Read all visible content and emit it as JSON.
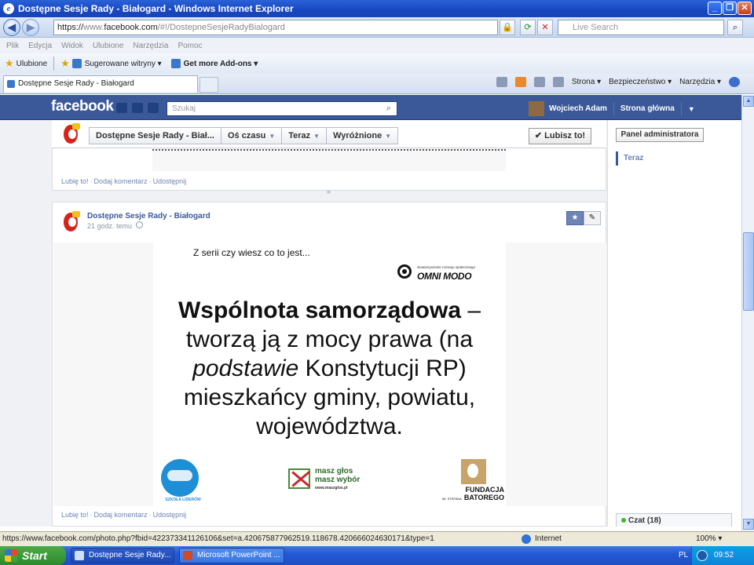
{
  "window": {
    "title": "Dostępne Sesje Rady - Białogard - Windows Internet Explorer"
  },
  "browser": {
    "url_scheme": "https://",
    "url_host_prefix": "www.",
    "url_host": "facebook.com",
    "url_path": "/#!/DostepneSesjeRadyBialogard",
    "live_search_placeholder": "Live Search",
    "menu": [
      "Plik",
      "Edycja",
      "Widok",
      "Ulubione",
      "Narzędzia",
      "Pomoc"
    ],
    "favorites_label": "Ulubione",
    "favorites_items": [
      "Sugerowane witryny ▾",
      "Get more Add-ons ▾"
    ],
    "tab_title": "Dostępne Sesje Rady - Białogard",
    "tools": [
      "Strona ▾",
      "Bezpieczeństwo ▾",
      "Narzędzia ▾"
    ],
    "status_url": "https://www.facebook.com/photo.php?fbid=422373341126106&set=a.420675877962519.118678.420666024630171&type=1",
    "zone": "Internet",
    "zoom": "100%"
  },
  "facebook": {
    "logo": "facebook",
    "search_placeholder": "Szukaj",
    "user_name": "Wojciech Adam",
    "home": "Strona główna",
    "page_nav": [
      "Dostępne Sesje Rady - Biał...",
      "Oś czasu",
      "Teraz",
      "Wyróżnione"
    ],
    "like_button": "✔ Lubisz to!",
    "post_actions": [
      "Lubię to!",
      "Dodaj komentarz",
      "Udostępnij"
    ],
    "post": {
      "author": "Dostępne Sesje Rady - Białogard",
      "time": "21 godz. temu"
    },
    "slide": {
      "intro": "Z serii czy wiesz co to jest...",
      "org_small": "stowarzyszenie rozwoju społecznego",
      "org_name": "OMNI MODO",
      "bold": "Wspólnota samorządowa",
      "dash": " –",
      "line1": "tworzą ją z mocy prawa (na",
      "italic": "podstawie",
      "line2b": " Konstytucji RP)",
      "line3": "mieszkańcy gminy, powiatu,",
      "line4": "województwa.",
      "logo1": "SZKOŁA LIDERÓW",
      "logo2a": "masz głos",
      "logo2b": "masz wybór",
      "logo2c": "www.maszglos.pl",
      "logo3a": "FUNDACJA",
      "logo3b": "BATOREGO",
      "logo3c": "IM. STEFANA"
    },
    "right": {
      "admin": "Panel administratora",
      "now": "Teraz",
      "chat": "Czat (18)"
    }
  },
  "taskbar": {
    "start": "Start",
    "tasks": [
      "Dostępne Sesje Rady...",
      "Microsoft PowerPoint ..."
    ],
    "lang": "PL",
    "clock": "09:52"
  }
}
